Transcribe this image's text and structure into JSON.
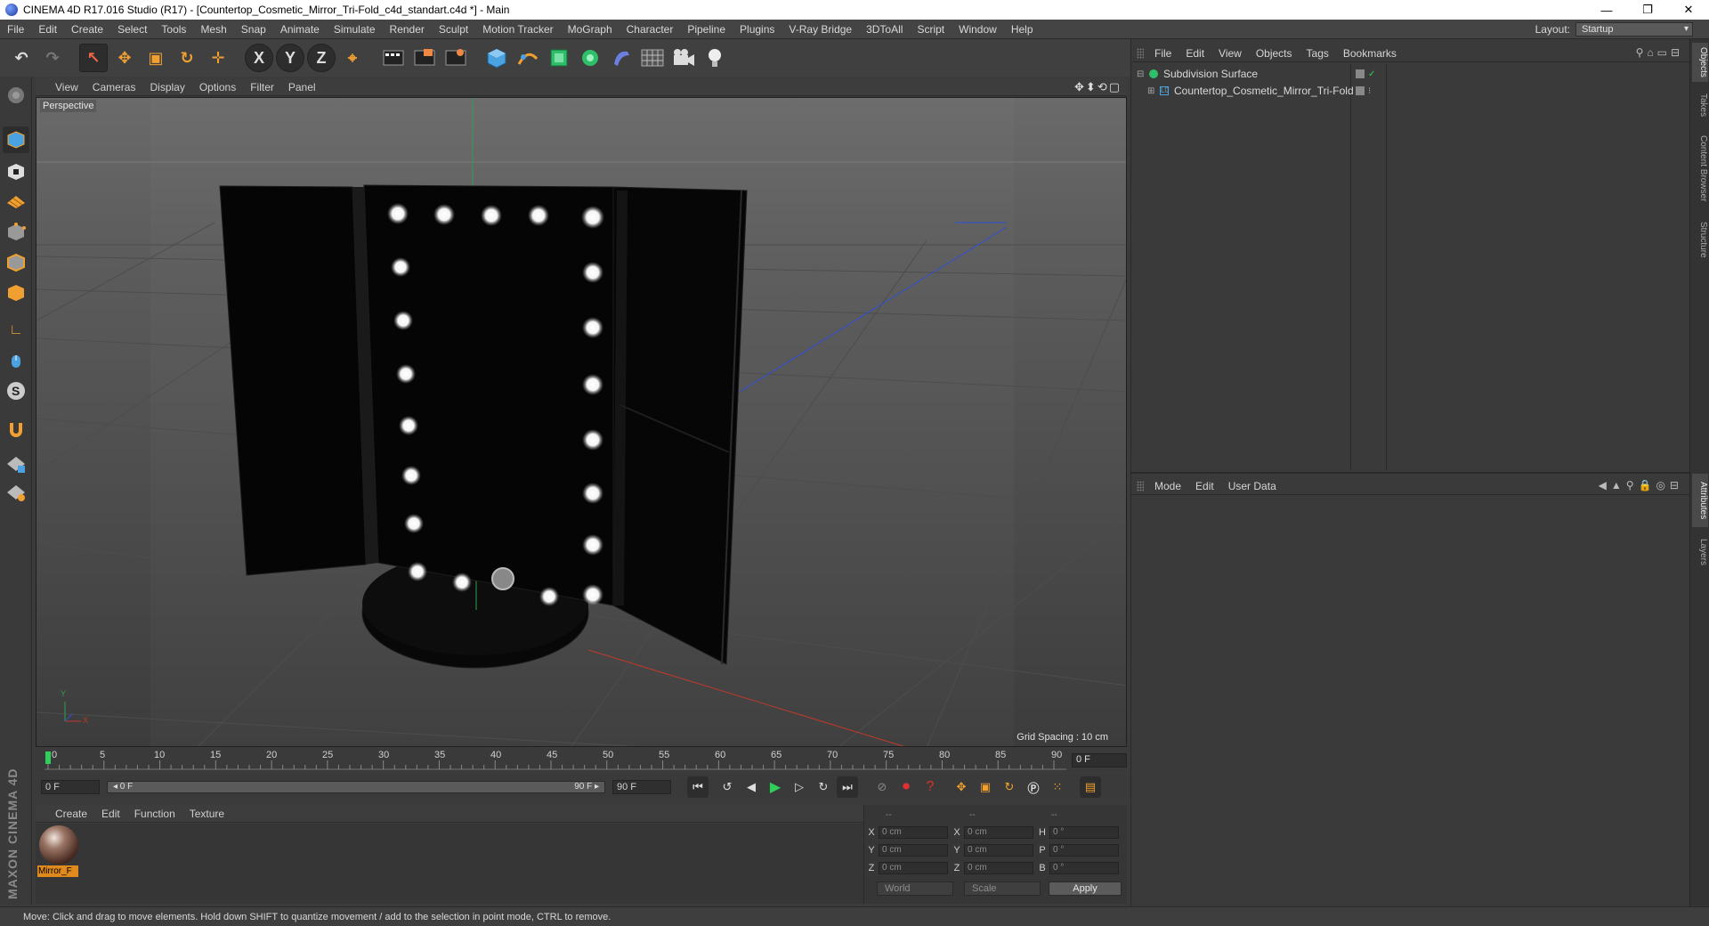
{
  "window": {
    "title": "CINEMA 4D R17.016 Studio (R17) - [Countertop_Cosmetic_Mirror_Tri-Fold_c4d_standart.c4d *] - Main",
    "minimize": "—",
    "maximize": "❐",
    "close": "✕"
  },
  "menubar": {
    "items": [
      "File",
      "Edit",
      "Create",
      "Select",
      "Tools",
      "Mesh",
      "Snap",
      "Animate",
      "Simulate",
      "Render",
      "Sculpt",
      "Motion Tracker",
      "MoGraph",
      "Character",
      "Pipeline",
      "Plugins",
      "V-Ray Bridge",
      "3DToAll",
      "Script",
      "Window",
      "Help"
    ],
    "layout_label": "Layout:",
    "layout_value": "Startup"
  },
  "toolbar": {
    "undo": "↶",
    "redo": "↷",
    "select": "↖",
    "move": "✥",
    "scale": "▣",
    "rotate": "↻",
    "place": "✛",
    "x": "X",
    "y": "Y",
    "z": "Z",
    "coord": "⌖"
  },
  "viewport": {
    "menu": [
      "View",
      "Cameras",
      "Display",
      "Options",
      "Filter",
      "Panel"
    ],
    "nav_icons": "✥⬍⟲▢",
    "label": "Perspective",
    "grid_spacing": "Grid Spacing : 10 cm",
    "axis_y": "Y",
    "axis_x": "X"
  },
  "timeline": {
    "ticks": [
      "0",
      "5",
      "10",
      "15",
      "20",
      "25",
      "30",
      "35",
      "40",
      "45",
      "50",
      "55",
      "60",
      "65",
      "70",
      "75",
      "80",
      "85",
      "90"
    ],
    "current_frame": "0 F"
  },
  "transport": {
    "start_field": "0 F",
    "range_start": "◂ 0 F",
    "range_end": "90 F ▸",
    "end_field": "90 F"
  },
  "material_manager": {
    "menu": [
      "Create",
      "Edit",
      "Function",
      "Texture"
    ],
    "material_name": "Mirror_F"
  },
  "coordinates": {
    "header": [
      "--",
      "--",
      "--"
    ],
    "rows": [
      {
        "l1": "X",
        "v1": "0 cm",
        "l2": "X",
        "v2": "0 cm",
        "l3": "H",
        "v3": "0 °"
      },
      {
        "l1": "Y",
        "v1": "0 cm",
        "l2": "Y",
        "v2": "0 cm",
        "l3": "P",
        "v3": "0 °"
      },
      {
        "l1": "Z",
        "v1": "0 cm",
        "l2": "Z",
        "v2": "0 cm",
        "l3": "B",
        "v3": "0 °"
      }
    ],
    "space": "World",
    "mode": "Scale",
    "apply": "Apply"
  },
  "object_manager": {
    "menu": [
      "File",
      "Edit",
      "View",
      "Objects",
      "Tags",
      "Bookmarks"
    ],
    "objects": [
      {
        "name": "Subdivision Surface",
        "indent": 0
      },
      {
        "name": "Countertop_Cosmetic_Mirror_Tri-Fold",
        "indent": 1
      }
    ]
  },
  "attribute_manager": {
    "menu": [
      "Mode",
      "Edit",
      "User Data"
    ]
  },
  "right_tabs": {
    "top": [
      "Objects",
      "Takes",
      "Content Browser",
      "Structure"
    ],
    "bottom": [
      "Attributes",
      "Layers"
    ]
  },
  "branding": "MAXON CINEMA 4D",
  "status": "Move: Click and drag to move elements. Hold down SHIFT to quantize movement / add to the selection in point mode, CTRL to remove.",
  "colors": {
    "accent_orange": "#e08a1e",
    "viewport_bg": "#5e5e5e",
    "axis_red": "#c0392b",
    "axis_green": "#27ae60",
    "axis_blue": "#2f4fd8"
  }
}
